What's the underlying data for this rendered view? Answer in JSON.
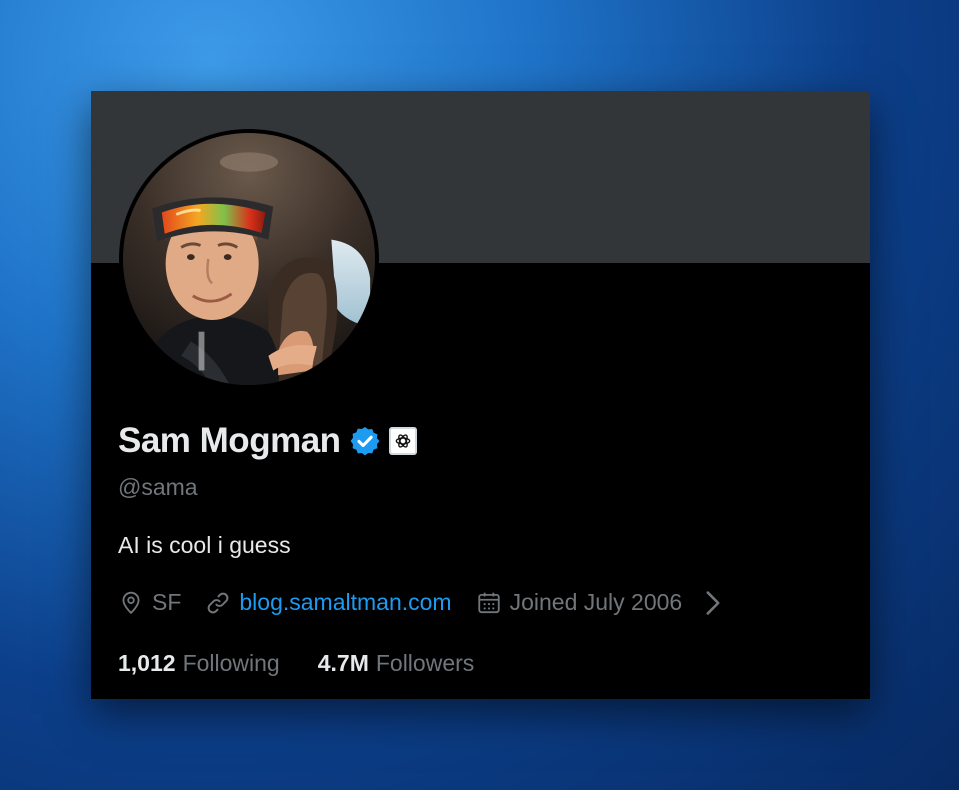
{
  "profile": {
    "name": "Sam Mogman",
    "handle": "@sama",
    "bio": "AI is cool i guess",
    "location": "SF",
    "website": "blog.samaltman.com",
    "joined": "Joined July 2006"
  },
  "stats": {
    "following_count": "1,012",
    "following_label": "Following",
    "followers_count": "4.7M",
    "followers_label": "Followers"
  },
  "icons": {
    "verified": "verified-badge-icon",
    "org": "openai-logo-icon",
    "location": "location-pin-icon",
    "link": "link-icon",
    "calendar": "calendar-icon",
    "chevron": "chevron-right-icon"
  },
  "colors": {
    "background_top": "#3d9be9",
    "background_bottom": "#072a63",
    "card": "#000000",
    "banner": "#333639",
    "primary_text": "#e7e9ea",
    "secondary_text": "#71767b",
    "link": "#1d9bf0",
    "verified": "#1d9bf0"
  }
}
